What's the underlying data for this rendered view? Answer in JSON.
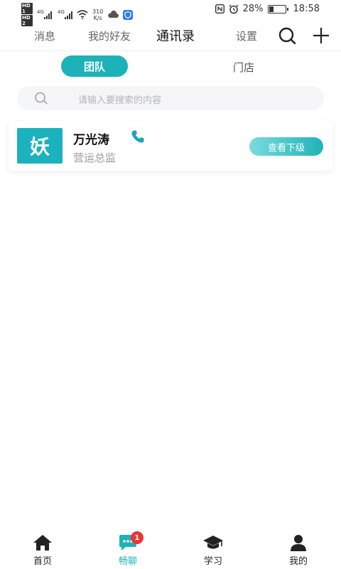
{
  "status_bar": {
    "hd1": "HD 1",
    "hd2": "HD 2",
    "net1": "4G",
    "net2": "4G",
    "speed_value": "310",
    "speed_unit": "K/s",
    "battery_percent": "28%",
    "battery_level": 0.28,
    "time": "18:58"
  },
  "top_nav": {
    "tabs": [
      {
        "label": "消息"
      },
      {
        "label": "我的好友"
      },
      {
        "label": "通讯录"
      },
      {
        "label": "设置"
      }
    ],
    "active_tab": "通讯录"
  },
  "segment": {
    "team_label": "团队",
    "store_label": "门店",
    "selected": "团队"
  },
  "search": {
    "placeholder": "请输入要搜索的内容"
  },
  "contact": {
    "avatar_char": "妖",
    "name": "万光涛",
    "role": "营运总监",
    "view_subordinates_label": "查看下级"
  },
  "bottom_nav": {
    "items": [
      {
        "label": "首页",
        "icon": "home-icon"
      },
      {
        "label": "畅聊",
        "icon": "chat-icon",
        "badge": "1"
      },
      {
        "label": "学习",
        "icon": "graduation-cap-icon"
      },
      {
        "label": "我的",
        "icon": "person-icon"
      }
    ],
    "active": "畅聊"
  },
  "colors": {
    "accent": "#1db2b7",
    "badge": "#e53935",
    "avatar_bg": "#1bb2bd"
  }
}
